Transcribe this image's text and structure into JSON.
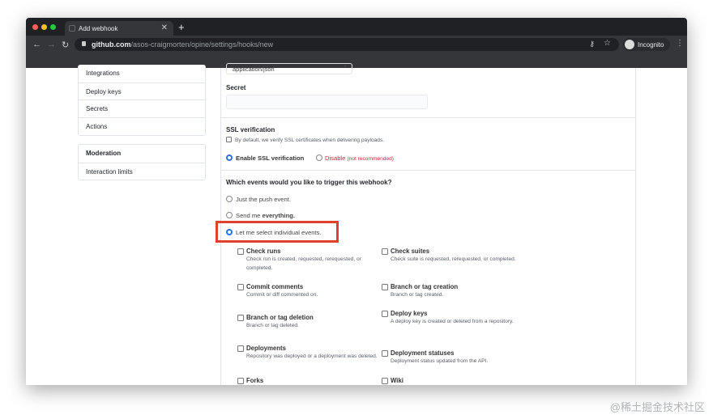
{
  "browser": {
    "tab_title": "Add webhook",
    "url_host": "github.com",
    "url_path": "/asos-craigmorten/opine/settings/hooks/new",
    "profile": "Incognito"
  },
  "sidebar": {
    "items": [
      "Integrations",
      "Deploy keys",
      "Secrets",
      "Actions"
    ],
    "moderation_header": "Moderation",
    "moderation_items": [
      "Interaction limits"
    ]
  },
  "form": {
    "content_type": "application/json",
    "secret_label": "Secret",
    "secret_value": "",
    "ssl": {
      "title": "SSL verification",
      "note": "By default, we verify SSL certificates when delivering payloads.",
      "enable": "Enable SSL verification",
      "disable": "Disable",
      "disable_note": "(not recommended)"
    },
    "events": {
      "question": "Which events would you like to trigger this webhook?",
      "opt1": "Just the push event.",
      "opt2a": "Send me ",
      "opt2b": "everything.",
      "opt3": "Let me select individual events.",
      "list": [
        {
          "title": "Check runs",
          "desc": "Check run is created, requested, rerequested, or completed."
        },
        {
          "title": "Check suites",
          "desc": "Check suite is requested, rerequested, or completed."
        },
        {
          "title": "Commit comments",
          "desc": "Commit or diff commented on."
        },
        {
          "title": "Branch or tag creation",
          "desc": "Branch or tag created."
        },
        {
          "title": "Branch or tag deletion",
          "desc": "Branch or tag deleted."
        },
        {
          "title": "Deploy keys",
          "desc": "A deploy key is created or deleted from a repository."
        },
        {
          "title": "Deployments",
          "desc": "Repository was deployed or a deployment was deleted."
        },
        {
          "title": "Deployment statuses",
          "desc": "Deployment status updated from the API."
        },
        {
          "title": "Forks",
          "desc": ""
        },
        {
          "title": "Wiki",
          "desc": ""
        }
      ]
    }
  },
  "watermark": "@稀土掘金技术社区",
  "colors": {
    "highlight": "#e0412c",
    "accent": "#2f6fe4",
    "danger": "#cb2431"
  }
}
